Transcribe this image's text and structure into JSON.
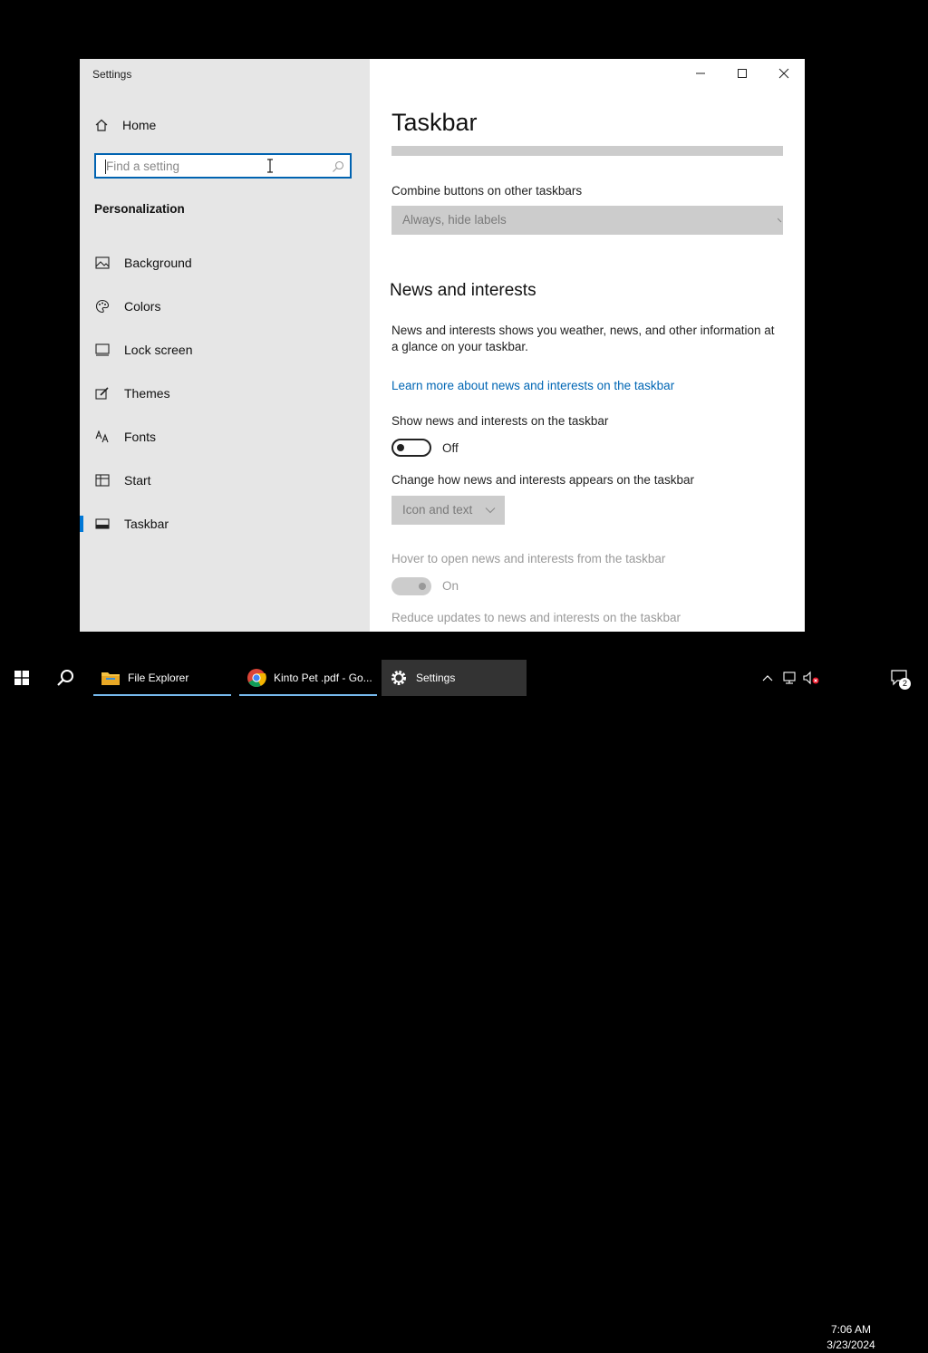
{
  "window": {
    "title": "Settings"
  },
  "sidebar": {
    "home_label": "Home",
    "search": {
      "placeholder": "Find a setting",
      "value": ""
    },
    "section_heading": "Personalization",
    "items": [
      {
        "label": "Background",
        "icon": "picture-icon"
      },
      {
        "label": "Colors",
        "icon": "palette-icon"
      },
      {
        "label": "Lock screen",
        "icon": "lock-screen-icon"
      },
      {
        "label": "Themes",
        "icon": "brush-icon"
      },
      {
        "label": "Fonts",
        "icon": "font-icon"
      },
      {
        "label": "Start",
        "icon": "start-icon"
      },
      {
        "label": "Taskbar",
        "icon": "taskbar-icon",
        "active": true
      }
    ]
  },
  "content": {
    "title": "Taskbar",
    "combine_label": "Combine buttons on other taskbars",
    "combine_value": "Always, hide labels",
    "news_heading": "News and interests",
    "news_description": "News and interests shows you weather, news, and other information at a glance on your taskbar.",
    "learn_more_link": "Learn more about news and interests on the taskbar",
    "show_news_label": "Show news and interests on the taskbar",
    "show_news_state": "Off",
    "appearance_label": "Change how news and interests appears on the taskbar",
    "appearance_value": "Icon and text",
    "hover_label": "Hover to open news and interests from the taskbar",
    "hover_state": "On",
    "reduce_label": "Reduce updates to news and interests on the taskbar"
  },
  "taskbar": {
    "apps": [
      {
        "label": "File Explorer",
        "icon": "folder-icon"
      },
      {
        "label": "Kinto Pet .pdf - Go...",
        "icon": "chrome-icon"
      },
      {
        "label": "Settings",
        "icon": "gear-icon",
        "active": true
      }
    ],
    "clock": {
      "time": "7:06 AM",
      "date": "3/23/2024"
    },
    "notification_count": "2"
  },
  "colors": {
    "accent": "#0078d7",
    "link": "#0066b4",
    "sidebar_bg": "#e6e6e6"
  }
}
